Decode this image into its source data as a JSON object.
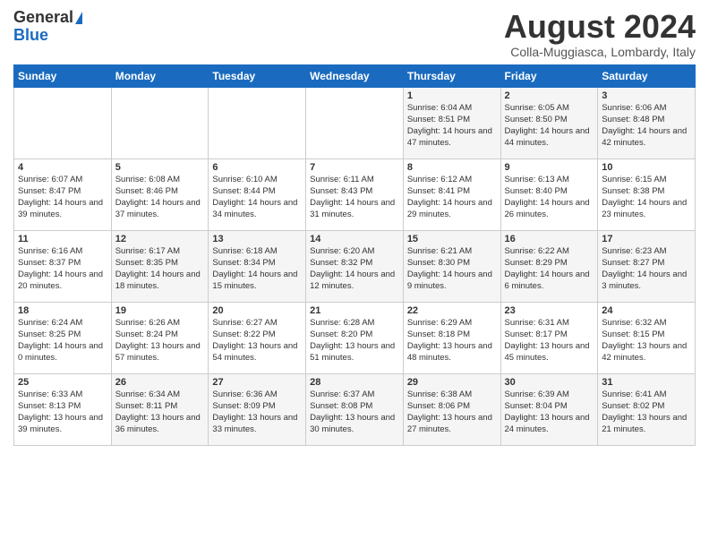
{
  "logo": {
    "general": "General",
    "blue": "Blue"
  },
  "header": {
    "month_year": "August 2024",
    "location": "Colla-Muggiasca, Lombardy, Italy"
  },
  "days_of_week": [
    "Sunday",
    "Monday",
    "Tuesday",
    "Wednesday",
    "Thursday",
    "Friday",
    "Saturday"
  ],
  "weeks": [
    [
      {
        "day": "",
        "info": ""
      },
      {
        "day": "",
        "info": ""
      },
      {
        "day": "",
        "info": ""
      },
      {
        "day": "",
        "info": ""
      },
      {
        "day": "1",
        "info": "Sunrise: 6:04 AM\nSunset: 8:51 PM\nDaylight: 14 hours and 47 minutes."
      },
      {
        "day": "2",
        "info": "Sunrise: 6:05 AM\nSunset: 8:50 PM\nDaylight: 14 hours and 44 minutes."
      },
      {
        "day": "3",
        "info": "Sunrise: 6:06 AM\nSunset: 8:48 PM\nDaylight: 14 hours and 42 minutes."
      }
    ],
    [
      {
        "day": "4",
        "info": "Sunrise: 6:07 AM\nSunset: 8:47 PM\nDaylight: 14 hours and 39 minutes."
      },
      {
        "day": "5",
        "info": "Sunrise: 6:08 AM\nSunset: 8:46 PM\nDaylight: 14 hours and 37 minutes."
      },
      {
        "day": "6",
        "info": "Sunrise: 6:10 AM\nSunset: 8:44 PM\nDaylight: 14 hours and 34 minutes."
      },
      {
        "day": "7",
        "info": "Sunrise: 6:11 AM\nSunset: 8:43 PM\nDaylight: 14 hours and 31 minutes."
      },
      {
        "day": "8",
        "info": "Sunrise: 6:12 AM\nSunset: 8:41 PM\nDaylight: 14 hours and 29 minutes."
      },
      {
        "day": "9",
        "info": "Sunrise: 6:13 AM\nSunset: 8:40 PM\nDaylight: 14 hours and 26 minutes."
      },
      {
        "day": "10",
        "info": "Sunrise: 6:15 AM\nSunset: 8:38 PM\nDaylight: 14 hours and 23 minutes."
      }
    ],
    [
      {
        "day": "11",
        "info": "Sunrise: 6:16 AM\nSunset: 8:37 PM\nDaylight: 14 hours and 20 minutes."
      },
      {
        "day": "12",
        "info": "Sunrise: 6:17 AM\nSunset: 8:35 PM\nDaylight: 14 hours and 18 minutes."
      },
      {
        "day": "13",
        "info": "Sunrise: 6:18 AM\nSunset: 8:34 PM\nDaylight: 14 hours and 15 minutes."
      },
      {
        "day": "14",
        "info": "Sunrise: 6:20 AM\nSunset: 8:32 PM\nDaylight: 14 hours and 12 minutes."
      },
      {
        "day": "15",
        "info": "Sunrise: 6:21 AM\nSunset: 8:30 PM\nDaylight: 14 hours and 9 minutes."
      },
      {
        "day": "16",
        "info": "Sunrise: 6:22 AM\nSunset: 8:29 PM\nDaylight: 14 hours and 6 minutes."
      },
      {
        "day": "17",
        "info": "Sunrise: 6:23 AM\nSunset: 8:27 PM\nDaylight: 14 hours and 3 minutes."
      }
    ],
    [
      {
        "day": "18",
        "info": "Sunrise: 6:24 AM\nSunset: 8:25 PM\nDaylight: 14 hours and 0 minutes."
      },
      {
        "day": "19",
        "info": "Sunrise: 6:26 AM\nSunset: 8:24 PM\nDaylight: 13 hours and 57 minutes."
      },
      {
        "day": "20",
        "info": "Sunrise: 6:27 AM\nSunset: 8:22 PM\nDaylight: 13 hours and 54 minutes."
      },
      {
        "day": "21",
        "info": "Sunrise: 6:28 AM\nSunset: 8:20 PM\nDaylight: 13 hours and 51 minutes."
      },
      {
        "day": "22",
        "info": "Sunrise: 6:29 AM\nSunset: 8:18 PM\nDaylight: 13 hours and 48 minutes."
      },
      {
        "day": "23",
        "info": "Sunrise: 6:31 AM\nSunset: 8:17 PM\nDaylight: 13 hours and 45 minutes."
      },
      {
        "day": "24",
        "info": "Sunrise: 6:32 AM\nSunset: 8:15 PM\nDaylight: 13 hours and 42 minutes."
      }
    ],
    [
      {
        "day": "25",
        "info": "Sunrise: 6:33 AM\nSunset: 8:13 PM\nDaylight: 13 hours and 39 minutes."
      },
      {
        "day": "26",
        "info": "Sunrise: 6:34 AM\nSunset: 8:11 PM\nDaylight: 13 hours and 36 minutes."
      },
      {
        "day": "27",
        "info": "Sunrise: 6:36 AM\nSunset: 8:09 PM\nDaylight: 13 hours and 33 minutes."
      },
      {
        "day": "28",
        "info": "Sunrise: 6:37 AM\nSunset: 8:08 PM\nDaylight: 13 hours and 30 minutes."
      },
      {
        "day": "29",
        "info": "Sunrise: 6:38 AM\nSunset: 8:06 PM\nDaylight: 13 hours and 27 minutes."
      },
      {
        "day": "30",
        "info": "Sunrise: 6:39 AM\nSunset: 8:04 PM\nDaylight: 13 hours and 24 minutes."
      },
      {
        "day": "31",
        "info": "Sunrise: 6:41 AM\nSunset: 8:02 PM\nDaylight: 13 hours and 21 minutes."
      }
    ]
  ]
}
